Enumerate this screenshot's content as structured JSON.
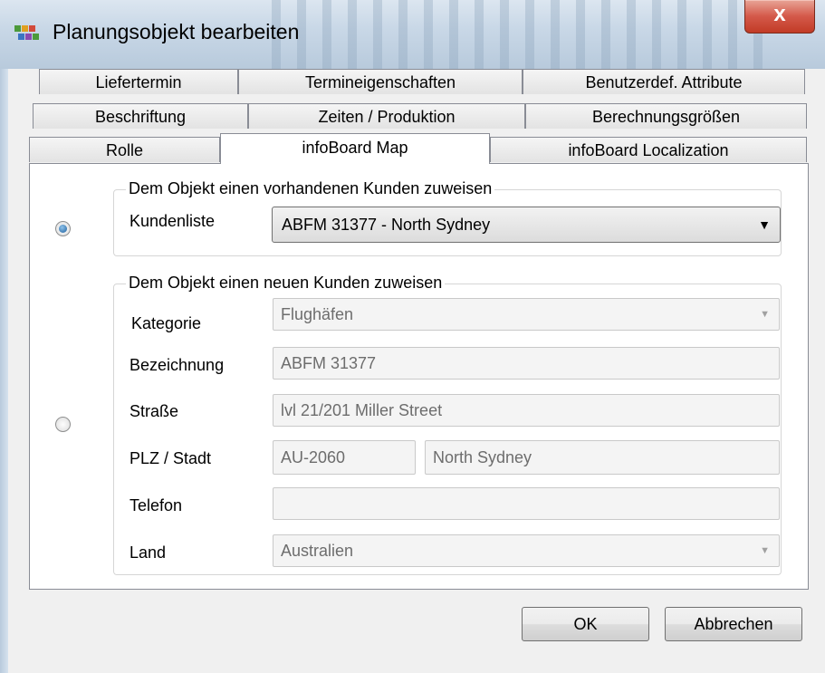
{
  "window": {
    "title": "Planungsobjekt bearbeiten",
    "close_glyph": "x"
  },
  "tabs": {
    "row1": [
      "Liefertermin",
      "Termineigenschaften",
      "Benutzerdef. Attribute"
    ],
    "row2": [
      "Beschriftung",
      "Zeiten / Produktion",
      "Berechnungsgrößen"
    ],
    "row3": [
      "Rolle",
      "infoBoard Map",
      "infoBoard Localization"
    ],
    "selected": "infoBoard Map"
  },
  "existing_customer": {
    "group_title": "Dem Objekt einen vorhandenen Kunden zuweisen",
    "radio_checked": true,
    "kundenliste_label": "Kundenliste",
    "kundenliste_value": "ABFM 31377 - North Sydney"
  },
  "new_customer": {
    "group_title": "Dem Objekt einen neuen Kunden zuweisen",
    "radio_checked": false,
    "kategorie_label": "Kategorie",
    "kategorie_value": "Flughäfen",
    "bezeichnung_label": "Bezeichnung",
    "bezeichnung_value": "ABFM 31377",
    "strasse_label": "Straße",
    "strasse_value": "lvl 21/201 Miller Street",
    "plz_stadt_label": "PLZ / Stadt",
    "plz_value": "AU-2060",
    "stadt_value": "North Sydney",
    "telefon_label": "Telefon",
    "telefon_value": "",
    "land_label": "Land",
    "land_value": "Australien"
  },
  "buttons": {
    "ok": "OK",
    "cancel": "Abbrechen"
  },
  "icons": {
    "app": "planning-app-icon",
    "dropdown": "chevron-down-icon",
    "close": "close-icon"
  }
}
